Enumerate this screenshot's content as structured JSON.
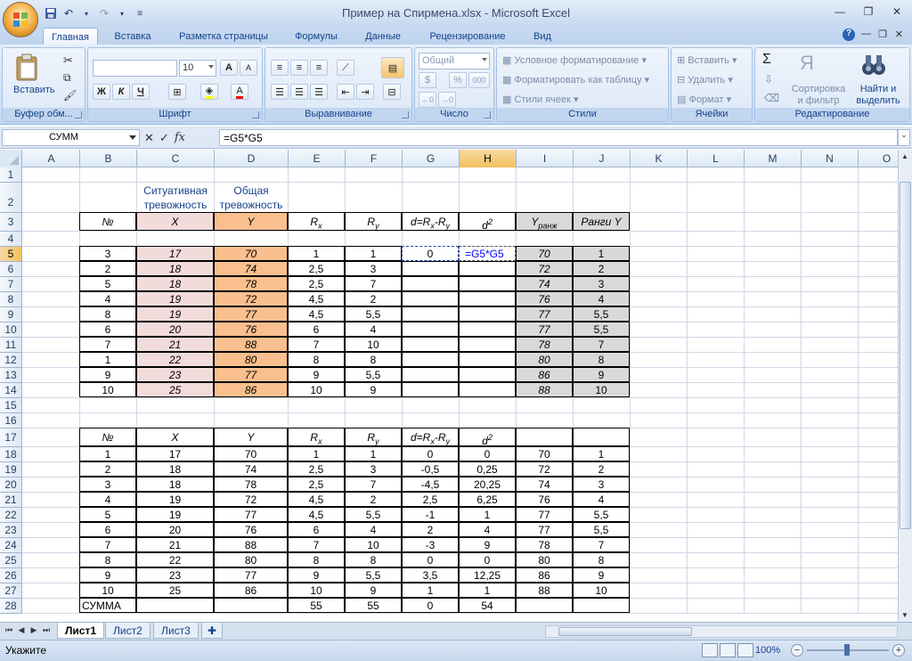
{
  "window": {
    "title": "Пример на Спирмена.xlsx - Microsoft Excel",
    "minimize": "—",
    "restore": "❐",
    "close": "✕"
  },
  "quick_access": [
    "save-icon",
    "undo-icon",
    "redo-icon",
    "customize-icon"
  ],
  "tabs": [
    "Главная",
    "Вставка",
    "Разметка страницы",
    "Формулы",
    "Данные",
    "Рецензирование",
    "Вид"
  ],
  "active_tab": "Главная",
  "ribbon": {
    "clipboard": {
      "label": "Буфер обм...",
      "paste": "Вставить"
    },
    "font": {
      "label": "Шрифт",
      "font_name": "",
      "font_size": "10",
      "bold": "Ж",
      "italic": "К",
      "underline": "Ч",
      "grow": "A",
      "shrink": "A"
    },
    "alignment": {
      "label": "Выравнивание"
    },
    "number": {
      "label": "Число",
      "format": "Общий",
      "percent": "%",
      "thousands": "000"
    },
    "styles": {
      "label": "Стили",
      "conditional": "Условное форматирование",
      "as_table": "Форматировать как таблицу",
      "cell_styles": "Стили ячеек"
    },
    "cells": {
      "label": "Ячейки",
      "insert": "Вставить",
      "delete": "Удалить",
      "format": "Формат"
    },
    "editing": {
      "label": "Редактирование",
      "sum": "Σ",
      "sort_line1": "Сортировка",
      "sort_line2": "и фильтр",
      "find_line1": "Найти и",
      "find_line2": "выделить"
    }
  },
  "formula_bar": {
    "name_box": "СУММ",
    "formula": "=G5*G5",
    "fx": "fx"
  },
  "grid": {
    "columns": [
      "A",
      "B",
      "C",
      "D",
      "E",
      "F",
      "G",
      "H",
      "I",
      "J",
      "K",
      "L",
      "M",
      "N",
      "O"
    ],
    "rows": [
      "1",
      "2",
      "3",
      "4",
      "5",
      "6",
      "7",
      "8",
      "9",
      "10",
      "11",
      "12",
      "13",
      "14",
      "15",
      "16",
      "17",
      "18",
      "19",
      "20",
      "21",
      "22",
      "23",
      "24",
      "25",
      "26",
      "27",
      "28"
    ],
    "selected_column": "H",
    "selected_row": "5",
    "table1_header_row2": {
      "C": "Ситуативная тревожность",
      "D": "Общая тревожность"
    },
    "table1_header_row3": {
      "B": "№",
      "C": "X",
      "D": "Y",
      "E": "R",
      "E_sub": "x",
      "F": "R",
      "F_sub": "y",
      "G": "d=R",
      "G_sub1": "x",
      "G_mid": "-R",
      "G_sub2": "y",
      "H": "d",
      "H_sup": "2",
      "I": "Y",
      "I_sub": "ранж",
      "J": "Ранги Y"
    },
    "table1_rows": [
      {
        "B": "3",
        "C": "17",
        "D": "70",
        "E": "1",
        "F": "1",
        "G": "0",
        "H": "=G5*G5",
        "I": "70",
        "J": "1"
      },
      {
        "B": "2",
        "C": "18",
        "D": "74",
        "E": "2,5",
        "F": "3",
        "G": "",
        "H": "",
        "I": "72",
        "J": "2"
      },
      {
        "B": "5",
        "C": "18",
        "D": "78",
        "E": "2,5",
        "F": "7",
        "G": "",
        "H": "",
        "I": "74",
        "J": "3"
      },
      {
        "B": "4",
        "C": "19",
        "D": "72",
        "E": "4,5",
        "F": "2",
        "G": "",
        "H": "",
        "I": "76",
        "J": "4"
      },
      {
        "B": "8",
        "C": "19",
        "D": "77",
        "E": "4,5",
        "F": "5,5",
        "G": "",
        "H": "",
        "I": "77",
        "J": "5,5"
      },
      {
        "B": "6",
        "C": "20",
        "D": "76",
        "E": "6",
        "F": "4",
        "G": "",
        "H": "",
        "I": "77",
        "J": "5,5"
      },
      {
        "B": "7",
        "C": "21",
        "D": "88",
        "E": "7",
        "F": "10",
        "G": "",
        "H": "",
        "I": "78",
        "J": "7"
      },
      {
        "B": "1",
        "C": "22",
        "D": "80",
        "E": "8",
        "F": "8",
        "G": "",
        "H": "",
        "I": "80",
        "J": "8"
      },
      {
        "B": "9",
        "C": "23",
        "D": "77",
        "E": "9",
        "F": "5,5",
        "G": "",
        "H": "",
        "I": "86",
        "J": "9"
      },
      {
        "B": "10",
        "C": "25",
        "D": "86",
        "E": "10",
        "F": "9",
        "G": "",
        "H": "",
        "I": "88",
        "J": "10"
      }
    ],
    "table2_header": {
      "B": "№",
      "C": "X",
      "D": "Y",
      "E": "R",
      "E_sub": "x",
      "F": "R",
      "F_sub": "y",
      "G": "d=R",
      "G_sub1": "x",
      "G_mid": "-R",
      "G_sub2": "y",
      "H": "d",
      "H_sup": "2"
    },
    "table2_rows": [
      {
        "B": "1",
        "C": "17",
        "D": "70",
        "E": "1",
        "F": "1",
        "G": "0",
        "H": "0",
        "I": "70",
        "J": "1"
      },
      {
        "B": "2",
        "C": "18",
        "D": "74",
        "E": "2,5",
        "F": "3",
        "G": "-0,5",
        "H": "0,25",
        "I": "72",
        "J": "2"
      },
      {
        "B": "3",
        "C": "18",
        "D": "78",
        "E": "2,5",
        "F": "7",
        "G": "-4,5",
        "H": "20,25",
        "I": "74",
        "J": "3"
      },
      {
        "B": "4",
        "C": "19",
        "D": "72",
        "E": "4,5",
        "F": "2",
        "G": "2,5",
        "H": "6,25",
        "I": "76",
        "J": "4"
      },
      {
        "B": "5",
        "C": "19",
        "D": "77",
        "E": "4,5",
        "F": "5,5",
        "G": "-1",
        "H": "1",
        "I": "77",
        "J": "5,5"
      },
      {
        "B": "6",
        "C": "20",
        "D": "76",
        "E": "6",
        "F": "4",
        "G": "2",
        "H": "4",
        "I": "77",
        "J": "5,5"
      },
      {
        "B": "7",
        "C": "21",
        "D": "88",
        "E": "7",
        "F": "10",
        "G": "-3",
        "H": "9",
        "I": "78",
        "J": "7"
      },
      {
        "B": "8",
        "C": "22",
        "D": "80",
        "E": "8",
        "F": "8",
        "G": "0",
        "H": "0",
        "I": "80",
        "J": "8"
      },
      {
        "B": "9",
        "C": "23",
        "D": "77",
        "E": "9",
        "F": "5,5",
        "G": "3,5",
        "H": "12,25",
        "I": "86",
        "J": "9"
      },
      {
        "B": "10",
        "C": "25",
        "D": "86",
        "E": "10",
        "F": "9",
        "G": "1",
        "H": "1",
        "I": "88",
        "J": "10"
      }
    ],
    "sum_row": {
      "B": "СУММА",
      "E": "55",
      "F": "55",
      "G": "0",
      "H": "54"
    },
    "colors": {
      "x_fill": "#f2dcdb",
      "y_fill": "#fabf8f",
      "rank_fill": "#d9d9d9",
      "header_select": "#f6c867",
      "formula_text": "#0000ff"
    }
  },
  "sheet_tabs": [
    "Лист1",
    "Лист2",
    "Лист3"
  ],
  "active_sheet": "Лист1",
  "status": {
    "mode": "Укажите",
    "zoom": "100%"
  }
}
